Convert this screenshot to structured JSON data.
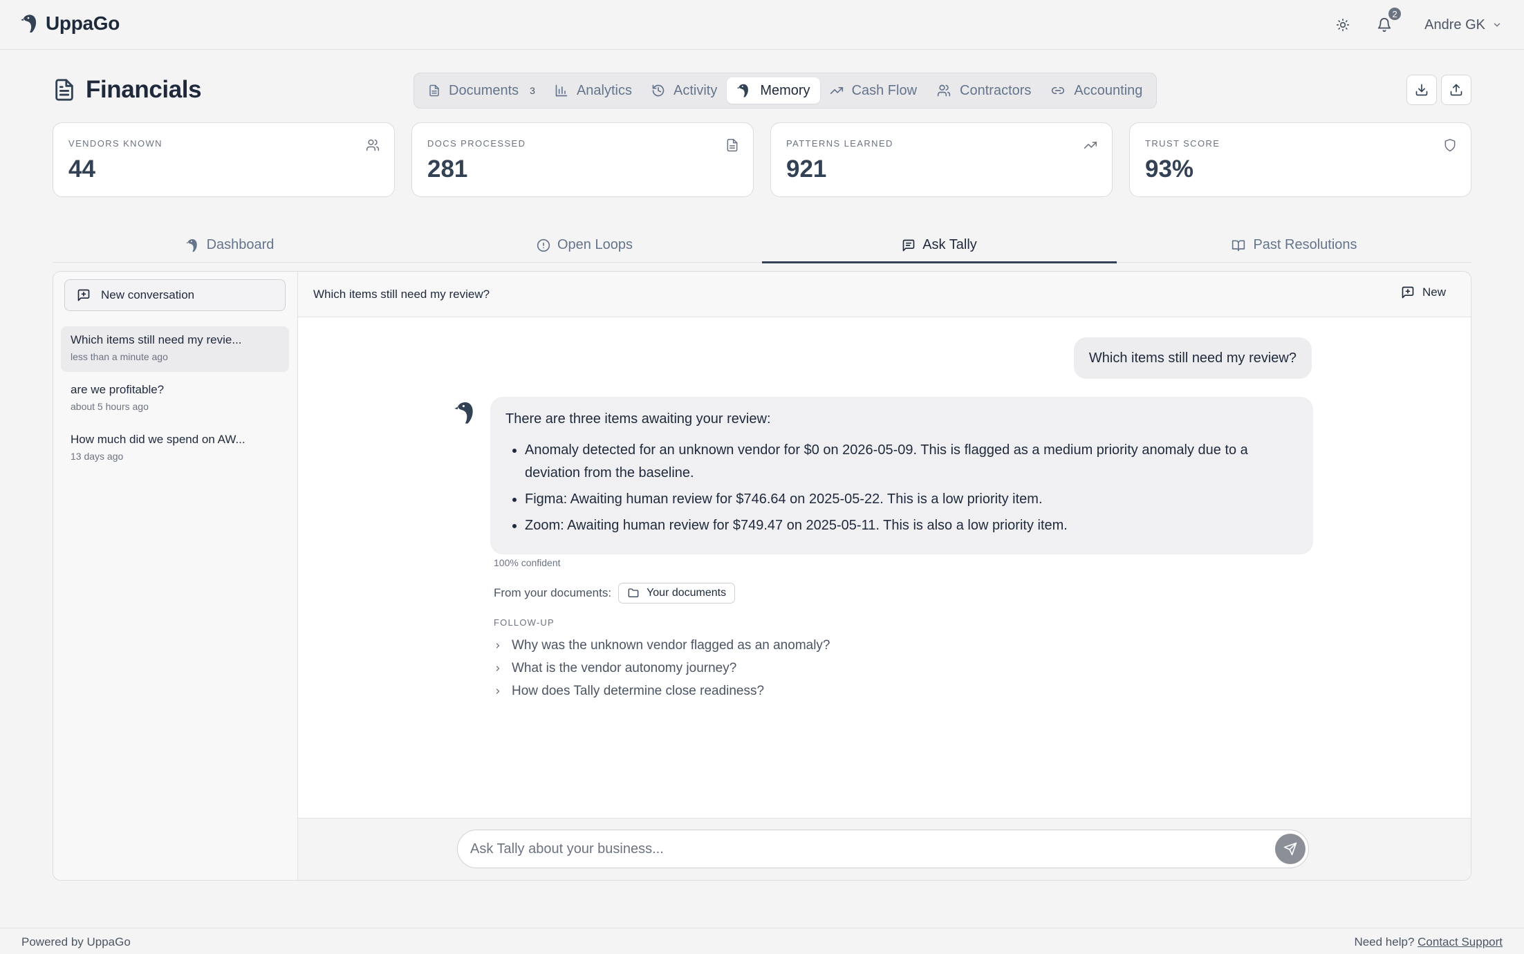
{
  "app": {
    "name": "UppaGo"
  },
  "topbar": {
    "notification_count": "2",
    "user_name": "Andre GK",
    "icons": [
      "sun-icon",
      "bell-icon",
      "chevron-down-icon"
    ]
  },
  "page": {
    "title": "Financials"
  },
  "tabs": [
    {
      "label": "Documents",
      "count": "3",
      "icon": "document-icon",
      "active": false
    },
    {
      "label": "Analytics",
      "icon": "bar-chart-icon",
      "active": false
    },
    {
      "label": "Activity",
      "icon": "history-icon",
      "active": false
    },
    {
      "label": "Memory",
      "icon": "bird-icon",
      "active": true
    },
    {
      "label": "Cash Flow",
      "icon": "trending-up-icon",
      "active": false
    },
    {
      "label": "Contractors",
      "icon": "users-icon",
      "active": false
    },
    {
      "label": "Accounting",
      "icon": "link-icon",
      "active": false
    }
  ],
  "stats": [
    {
      "label": "VENDORS KNOWN",
      "value": "44",
      "icon": "users-icon"
    },
    {
      "label": "DOCS PROCESSED",
      "value": "281",
      "icon": "file-icon"
    },
    {
      "label": "PATTERNS LEARNED",
      "value": "921",
      "icon": "trending-up-icon"
    },
    {
      "label": "TRUST SCORE",
      "value": "93%",
      "icon": "shield-icon"
    }
  ],
  "subtabs": [
    {
      "label": "Dashboard",
      "icon": "bird-icon",
      "active": false
    },
    {
      "label": "Open Loops",
      "icon": "alert-circle-icon",
      "active": false
    },
    {
      "label": "Ask Tally",
      "icon": "message-square-icon",
      "active": true
    },
    {
      "label": "Past Resolutions",
      "icon": "book-open-icon",
      "active": false
    }
  ],
  "sidebar": {
    "new_conversation_label": "New conversation",
    "conversations": [
      {
        "title": "Which items still need my revie...",
        "time": "less than a minute ago",
        "active": true
      },
      {
        "title": "are we profitable?",
        "time": "about 5 hours ago",
        "active": false
      },
      {
        "title": "How much did we spend on AW...",
        "time": "13 days ago",
        "active": false
      }
    ]
  },
  "chat": {
    "header_title": "Which items still need my review?",
    "new_label": "New",
    "user_message": "Which items still need my review?",
    "assistant": {
      "intro": "There are three items awaiting your review:",
      "bullets": [
        "Anomaly detected for an unknown vendor for $0 on 2026-05-09. This is flagged as a medium priority anomaly due to a deviation from the baseline.",
        "Figma: Awaiting human review for $746.64 on 2025-05-22. This is a low priority item.",
        "Zoom: Awaiting human review for $749.47 on 2025-05-11. This is also a low priority item."
      ],
      "confidence": "100% confident",
      "sources_label": "From your documents:",
      "source_chip": "Your documents",
      "followup_label": "FOLLOW-UP",
      "followups": [
        "Why was the unknown vendor flagged as an anomaly?",
        "What is the vendor autonomy journey?",
        "How does Tally determine close readiness?"
      ]
    },
    "input_placeholder": "Ask Tally about your business..."
  },
  "footer": {
    "left": "Powered by UppaGo",
    "help_prefix": "Need help?",
    "help_link": "Contact Support"
  },
  "colors": {
    "accent": "#334155",
    "background": "#f4f4f5",
    "send_button": "#8b8f98"
  }
}
